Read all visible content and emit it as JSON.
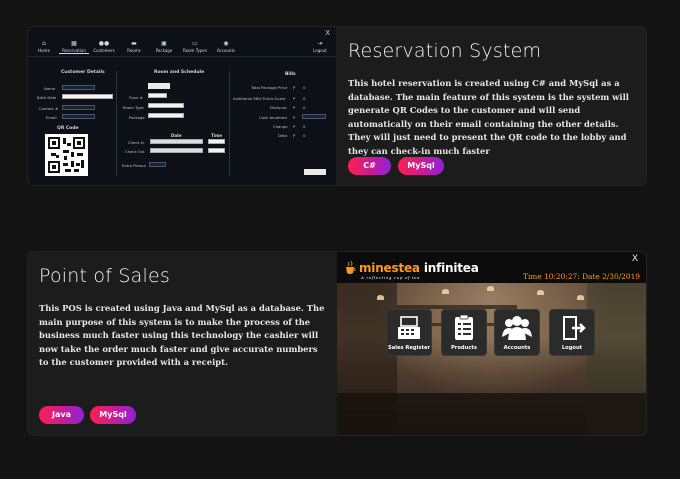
{
  "projects": [
    {
      "title": "Reservation System",
      "description": "This hotel reservation is created using C# and MySql as a database. The main feature of this system is the system will generate QR Codes to the customer and will send automatically on their email containing the other details. They will just need to present the QR code to the lobby and they can check-in much faster",
      "tags": [
        "C#",
        "MySql"
      ],
      "screenshot": {
        "close": "X",
        "nav": [
          "Home",
          "Reservation",
          "Customers",
          "Rooms",
          "Package",
          "Room Types",
          "Accounts",
          "Logout"
        ],
        "customer_details": {
          "heading": "Customer Details",
          "fields": [
            "Name",
            "Birth Date",
            "Contact #",
            "Email"
          ],
          "qr_heading": "QR Code"
        },
        "room_schedule": {
          "heading": "Room and Schedule",
          "fields": [
            "Floor #",
            "Room Type",
            "Package"
          ],
          "date_heading": "Date",
          "time_heading": "Time",
          "dates": [
            "Check In",
            "Check Out"
          ],
          "extra": "Extra Person"
        },
        "bills": {
          "heading": "Bills",
          "rows": [
            "Total Package Price",
            "Additional 980/ Extra Guest",
            "Discount",
            "Cash tendered",
            "Change",
            "Debt"
          ],
          "currency": "P",
          "value": "0"
        }
      }
    },
    {
      "title": "Point of Sales",
      "description": "This POS is created using Java and MySql as a database. The main purpose of this system is to make the process of the business much faster using this technology the cashier will now take the order much faster and give accurate numbers to the customer provided with a receipt.",
      "tags": [
        "Java",
        "MySql"
      ],
      "screenshot": {
        "close": "X",
        "brand_first": "minestea",
        "brand_second": "infinitea",
        "tagline": "A reflecting cup of tea",
        "time": "Time 10:20:27: Date  2/30/2019",
        "tiles": [
          "Sales Register",
          "Products",
          "Accounts",
          "Logout"
        ]
      }
    }
  ]
}
